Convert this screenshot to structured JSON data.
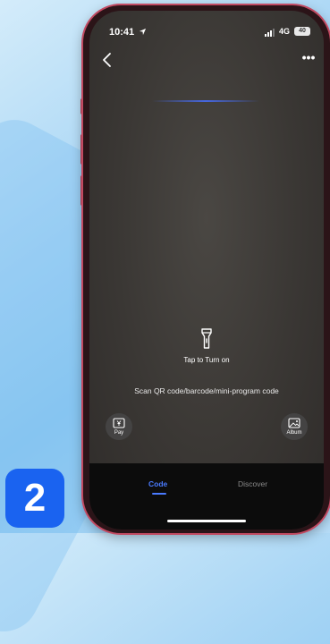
{
  "status_bar": {
    "time": "10:41",
    "network": "4G",
    "battery": "40"
  },
  "scanner": {
    "torch_label": "Tap to Turn on",
    "hint": "Scan QR code/barcode/mini-program code"
  },
  "actions": {
    "pay_label": "Pay",
    "album_label": "Album"
  },
  "tabs": [
    {
      "label": "Code",
      "active": true
    },
    {
      "label": "Discover",
      "active": false
    }
  ],
  "step_badge": "2",
  "icons": [
    "location-arrow-icon",
    "signal-icon",
    "back-icon",
    "more-icon",
    "flashlight-icon",
    "pay-icon",
    "album-icon"
  ],
  "colors": {
    "accent": "#4a7bff",
    "badge": "#1a63f0",
    "frame": "#c24a62"
  }
}
